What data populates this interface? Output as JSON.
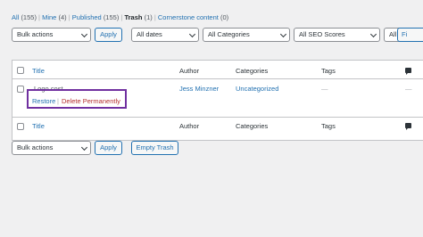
{
  "views": {
    "all_label": "All",
    "all_count": "(155)",
    "mine_label": "Mine",
    "mine_count": "(4)",
    "published_label": "Published",
    "published_count": "(155)",
    "trash_label": "Trash",
    "trash_count": "(1)",
    "cornerstone_label": "Cornerstone content",
    "cornerstone_count": "(0)",
    "separator": "|"
  },
  "top_filters": {
    "bulk_actions": "Bulk actions",
    "apply": "Apply",
    "dates": "All dates",
    "categories": "All Categories",
    "seo": "All SEO Scores",
    "readability": "All Rea",
    "filter_partial": "Fi"
  },
  "columns": {
    "title": "Title",
    "author": "Author",
    "categories": "Categories",
    "tags": "Tags"
  },
  "post": {
    "title": "Logo cost",
    "restore": "Restore",
    "sep": "|",
    "delete_permanently": "Delete Permanently",
    "author": "Jess Minzner",
    "category": "Uncategorized",
    "tags": "—",
    "comments": "—"
  },
  "bottom_filters": {
    "bulk_actions": "Bulk actions",
    "apply": "Apply",
    "empty_trash": "Empty Trash"
  }
}
